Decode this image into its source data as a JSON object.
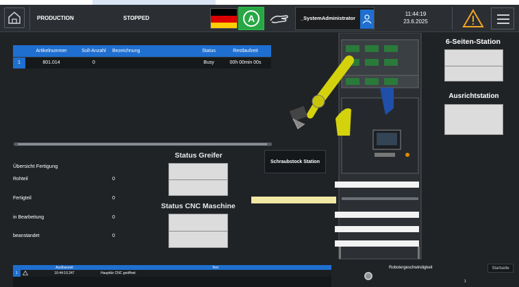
{
  "header": {
    "mode": "PRODUCTION",
    "state": "STOPPED",
    "user": "_SystemAdministrator",
    "time": "11:44:19",
    "date": "23.6.2025",
    "auto_symbol": "A",
    "flag_colors": [
      "#000000",
      "#dd0000",
      "#ffce00"
    ],
    "icons": [
      "home-icon",
      "german-flag-icon",
      "automatic-mode-icon",
      "hand-mode-icon",
      "user-icon",
      "warning-icon",
      "menu-icon"
    ]
  },
  "article_table": {
    "columns": [
      "Artikelnummer",
      "Soll-Anzahl",
      "Bezeichnung",
      "Status",
      "Restlaufzeit"
    ],
    "rows": [
      {
        "index": "1",
        "artikelnummer": "801.014",
        "soll_anzahl": "0",
        "bezeichnung": "",
        "status": "Busy",
        "restlaufzeit": "00h 00min 00s"
      }
    ]
  },
  "overview": {
    "title": "Übersicht Fertigung",
    "rows": [
      {
        "label": "Rohteil",
        "value": "0"
      },
      {
        "label": "Fertigteil",
        "value": "0"
      },
      {
        "label": "in Bearbeitung",
        "value": "0"
      },
      {
        "label": "beanstandet",
        "value": "0"
      }
    ]
  },
  "status": {
    "greifer_title": "Status Greifer",
    "cnc_title": "Status CNC Maschine"
  },
  "schraubstock_label": "Schraubstock Station",
  "stations": {
    "six_sided_title": "6-Seiten-Station",
    "alignment_title": "Ausrichtstation"
  },
  "alarm_table": {
    "columns": [
      "Auslösezeit",
      "Text"
    ],
    "rows": [
      {
        "index": "1",
        "time": "10:44:10.247",
        "text": "Haupttür CNC geöffnet"
      }
    ]
  },
  "robot_speed": {
    "label": "Robotergeschwindigkeit",
    "value": "1"
  },
  "start_label": "Startseite",
  "colors": {
    "accent_blue": "#1f6fd0",
    "auto_green": "#27a844",
    "warning_orange": "#f5a623",
    "robot_yellow": "#d4d20c"
  }
}
